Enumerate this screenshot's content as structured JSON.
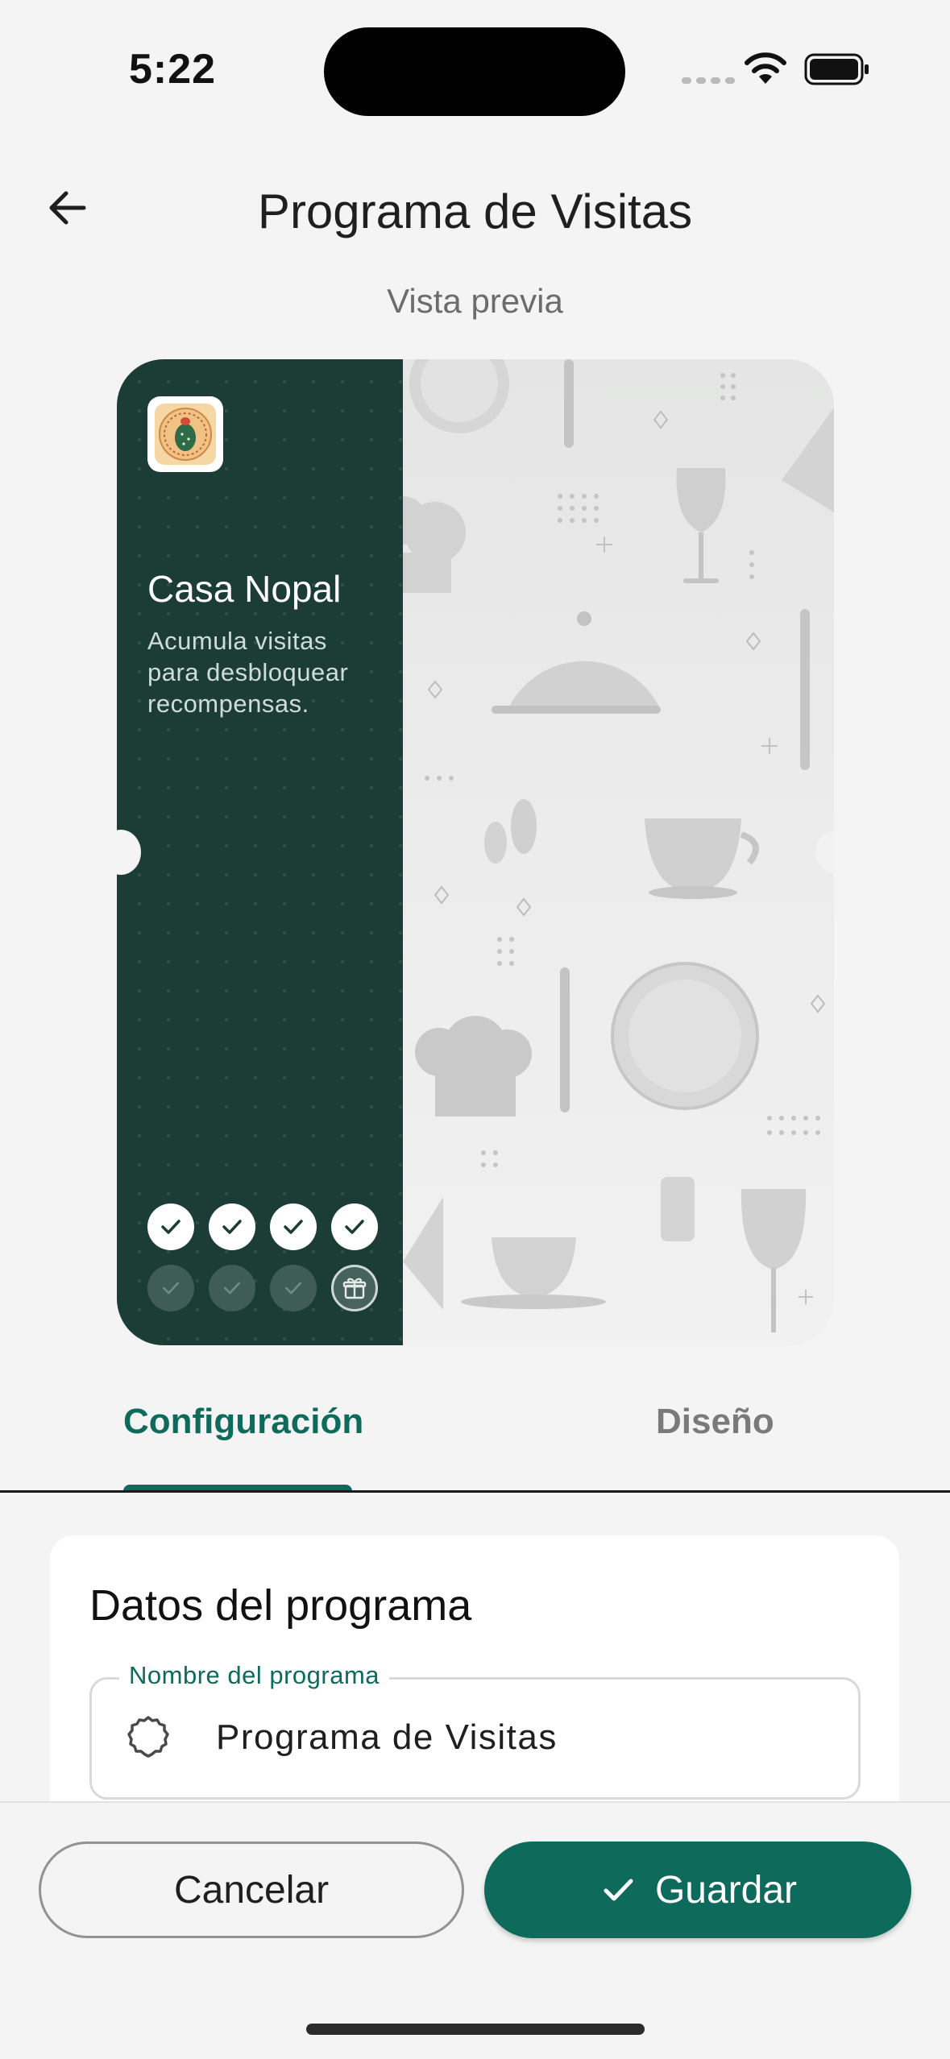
{
  "status_bar": {
    "time": "5:22"
  },
  "header": {
    "title": "Programa de Visitas"
  },
  "preview": {
    "label": "Vista previa"
  },
  "card": {
    "brand_name": "Casa Nopal",
    "description": "Acumula visitas para desbloquear recompensas.",
    "colors": {
      "panel": "#1b3d35",
      "accent": "#0e6b5c"
    },
    "stamps_total": 8,
    "stamps_completed": 4
  },
  "tabs": [
    {
      "label": "Configuración",
      "active": true
    },
    {
      "label": "Diseño",
      "active": false
    }
  ],
  "form": {
    "section_title": "Datos del programa",
    "program_name": {
      "label": "Nombre del programa",
      "value": "Programa de Visitas",
      "icon": "badge-icon"
    }
  },
  "actions": {
    "cancel_label": "Cancelar",
    "save_label": "Guardar"
  }
}
